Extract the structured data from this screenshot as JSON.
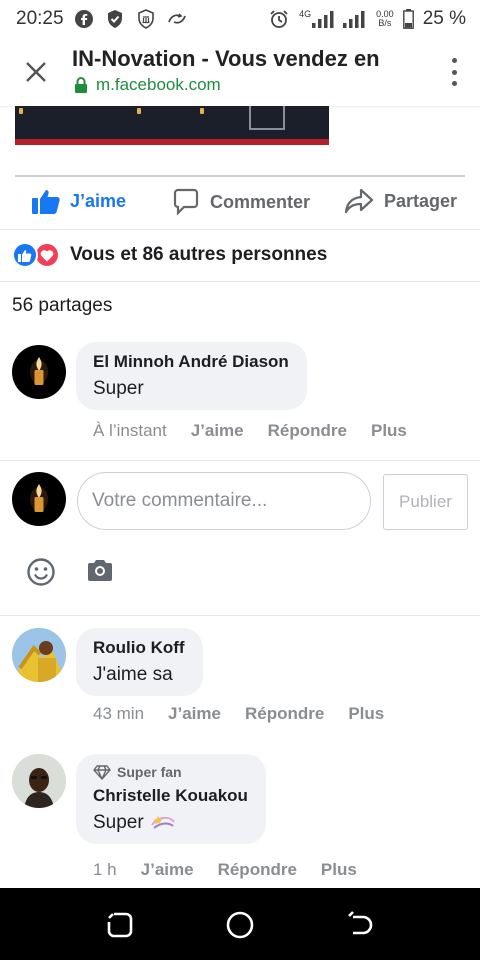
{
  "status_bar": {
    "time": "20:25",
    "network_label": "4G",
    "speed_value": "0.00",
    "speed_unit": "B/s",
    "battery": "25 %",
    "left_icons": [
      "facebook-icon",
      "shield-check-icon",
      "shield-bank-icon",
      "cloud-sync-icon"
    ],
    "right_icons": [
      "alarm-icon",
      "signal-icon",
      "signal-icon",
      "battery-icon"
    ]
  },
  "browser": {
    "title": "IN-Novation - Vous vendez en",
    "url": "m.facebook.com",
    "icons": [
      "close-icon",
      "lock-icon",
      "more-vertical-icon"
    ]
  },
  "actions": {
    "like": "J’aime",
    "comment": "Commenter",
    "share": "Partager",
    "icons": [
      "thumbs-up-icon",
      "comment-icon",
      "share-icon"
    ]
  },
  "post_stats": {
    "reactions_text": "Vous et 86 autres personnes",
    "shares_text": "56 partages",
    "reaction_icons": [
      "like-reaction-icon",
      "love-reaction-icon"
    ]
  },
  "comments": [
    {
      "author": "El Minnoh André Diason",
      "text": "Super",
      "time": "À l’instant",
      "like": "J’aime",
      "reply": "Répondre",
      "more": "Plus"
    },
    {
      "author": "Roulio Koff",
      "text": "J'aime sa",
      "time": "43 min",
      "like": "J’aime",
      "reply": "Répondre",
      "more": "Plus"
    },
    {
      "badge": "Super fan",
      "author": "Christelle Kouakou",
      "text": "Super",
      "time": "1 h",
      "like": "J’aime",
      "reply": "Répondre",
      "more": "Plus"
    }
  ],
  "composer": {
    "placeholder": "Votre commentaire...",
    "publish": "Publier",
    "icons": [
      "emoji-icon",
      "camera-icon"
    ]
  },
  "nav": {
    "icons": [
      "recent-apps-icon",
      "home-icon",
      "back-icon"
    ]
  },
  "colors": {
    "facebook_blue": "#1877f2",
    "love_red": "#f33e58",
    "secure_green": "#1e8e3e",
    "bubble_gray": "#f0f2f5"
  }
}
